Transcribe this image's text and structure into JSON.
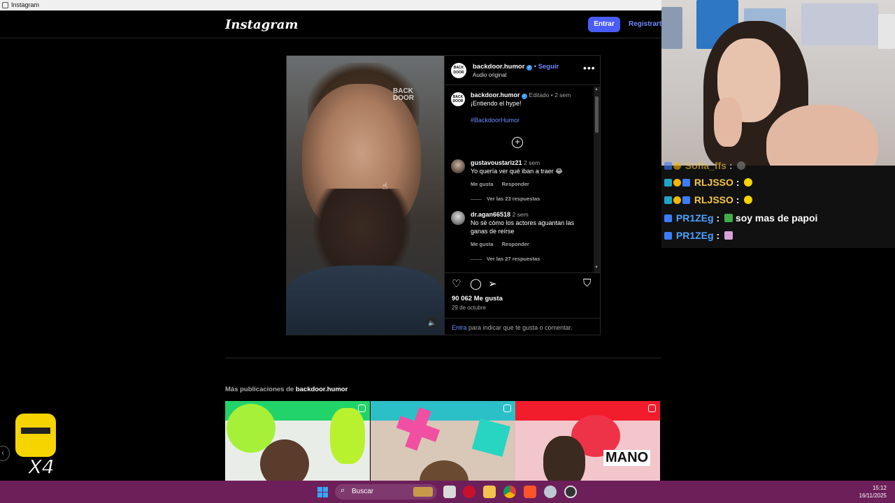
{
  "window": {
    "title": "Instagram"
  },
  "header": {
    "logo": "Instagram",
    "login_label": "Entrar",
    "signup_label": "Registrarte"
  },
  "post": {
    "media_watermark_line1": "BACK",
    "media_watermark_line2": "DOOR",
    "username": "backdoor.humor",
    "separator": "•",
    "follow_label": "Seguir",
    "audio_label": "Audio original",
    "more_glyph": "•••",
    "avatar_text": "BACK DOOR",
    "caption": {
      "username": "backdoor.humor",
      "meta": "Editado • 2 sem",
      "text": "¡Entiendo el hype!",
      "hashtag": "#BackdoorHumor"
    },
    "comments": [
      {
        "username": "gustavoustariz21",
        "time": "2 sem",
        "text": "Yo quería ver qué iban a traer 😂",
        "like_label": "Me gusta",
        "reply_label": "Responder",
        "replies_label": "Ver las 23 respuestas"
      },
      {
        "username": "dr.agan66518",
        "time": "2 sem",
        "text": "No sé cómo los actores aguantan las ganas de reírse",
        "like_label": "Me gusta",
        "reply_label": "Responder",
        "replies_label": "Ver las 27 respuestas"
      }
    ],
    "likes": "90 062 Me gusta",
    "date": "29 de octubre",
    "login_link": "Entra",
    "login_prompt": "para indicar que te gusta o comentar."
  },
  "more_posts": {
    "label_prefix": "Más publicaciones de",
    "username": "backdoor.humor",
    "thumb3_text": "MANO"
  },
  "chat": {
    "lines": [
      {
        "user": "Sofia_ffs",
        "message": "",
        "user_color": "#f4c542"
      },
      {
        "user": "RLJSSO",
        "message": "",
        "user_color": "#f4c542"
      },
      {
        "user": "RLJSSO",
        "message": "",
        "user_color": "#f4c542"
      },
      {
        "user": "PR1ZEg",
        "message": "soy mas de papoi",
        "user_color": "#4aa3ff"
      },
      {
        "user": "PR1ZEg",
        "message": "",
        "user_color": "#4aa3ff"
      }
    ]
  },
  "overlay": {
    "multiplier": "X4"
  },
  "taskbar": {
    "search_placeholder": "Buscar",
    "time": "15:12",
    "date": "16/11/2025"
  },
  "colors": {
    "accent": "#4a5df9",
    "link": "#6f8bff",
    "taskbar": "#6d1f5a"
  }
}
